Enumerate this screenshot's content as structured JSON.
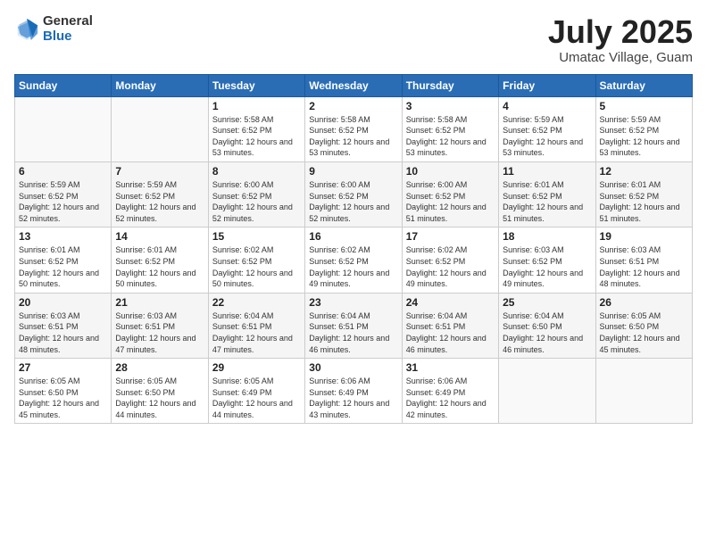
{
  "logo": {
    "general": "General",
    "blue": "Blue"
  },
  "header": {
    "month": "July 2025",
    "location": "Umatac Village, Guam"
  },
  "weekdays": [
    "Sunday",
    "Monday",
    "Tuesday",
    "Wednesday",
    "Thursday",
    "Friday",
    "Saturday"
  ],
  "weeks": [
    [
      {
        "day": "",
        "detail": ""
      },
      {
        "day": "",
        "detail": ""
      },
      {
        "day": "1",
        "detail": "Sunrise: 5:58 AM\nSunset: 6:52 PM\nDaylight: 12 hours and 53 minutes."
      },
      {
        "day": "2",
        "detail": "Sunrise: 5:58 AM\nSunset: 6:52 PM\nDaylight: 12 hours and 53 minutes."
      },
      {
        "day": "3",
        "detail": "Sunrise: 5:58 AM\nSunset: 6:52 PM\nDaylight: 12 hours and 53 minutes."
      },
      {
        "day": "4",
        "detail": "Sunrise: 5:59 AM\nSunset: 6:52 PM\nDaylight: 12 hours and 53 minutes."
      },
      {
        "day": "5",
        "detail": "Sunrise: 5:59 AM\nSunset: 6:52 PM\nDaylight: 12 hours and 53 minutes."
      }
    ],
    [
      {
        "day": "6",
        "detail": "Sunrise: 5:59 AM\nSunset: 6:52 PM\nDaylight: 12 hours and 52 minutes."
      },
      {
        "day": "7",
        "detail": "Sunrise: 5:59 AM\nSunset: 6:52 PM\nDaylight: 12 hours and 52 minutes."
      },
      {
        "day": "8",
        "detail": "Sunrise: 6:00 AM\nSunset: 6:52 PM\nDaylight: 12 hours and 52 minutes."
      },
      {
        "day": "9",
        "detail": "Sunrise: 6:00 AM\nSunset: 6:52 PM\nDaylight: 12 hours and 52 minutes."
      },
      {
        "day": "10",
        "detail": "Sunrise: 6:00 AM\nSunset: 6:52 PM\nDaylight: 12 hours and 51 minutes."
      },
      {
        "day": "11",
        "detail": "Sunrise: 6:01 AM\nSunset: 6:52 PM\nDaylight: 12 hours and 51 minutes."
      },
      {
        "day": "12",
        "detail": "Sunrise: 6:01 AM\nSunset: 6:52 PM\nDaylight: 12 hours and 51 minutes."
      }
    ],
    [
      {
        "day": "13",
        "detail": "Sunrise: 6:01 AM\nSunset: 6:52 PM\nDaylight: 12 hours and 50 minutes."
      },
      {
        "day": "14",
        "detail": "Sunrise: 6:01 AM\nSunset: 6:52 PM\nDaylight: 12 hours and 50 minutes."
      },
      {
        "day": "15",
        "detail": "Sunrise: 6:02 AM\nSunset: 6:52 PM\nDaylight: 12 hours and 50 minutes."
      },
      {
        "day": "16",
        "detail": "Sunrise: 6:02 AM\nSunset: 6:52 PM\nDaylight: 12 hours and 49 minutes."
      },
      {
        "day": "17",
        "detail": "Sunrise: 6:02 AM\nSunset: 6:52 PM\nDaylight: 12 hours and 49 minutes."
      },
      {
        "day": "18",
        "detail": "Sunrise: 6:03 AM\nSunset: 6:52 PM\nDaylight: 12 hours and 49 minutes."
      },
      {
        "day": "19",
        "detail": "Sunrise: 6:03 AM\nSunset: 6:51 PM\nDaylight: 12 hours and 48 minutes."
      }
    ],
    [
      {
        "day": "20",
        "detail": "Sunrise: 6:03 AM\nSunset: 6:51 PM\nDaylight: 12 hours and 48 minutes."
      },
      {
        "day": "21",
        "detail": "Sunrise: 6:03 AM\nSunset: 6:51 PM\nDaylight: 12 hours and 47 minutes."
      },
      {
        "day": "22",
        "detail": "Sunrise: 6:04 AM\nSunset: 6:51 PM\nDaylight: 12 hours and 47 minutes."
      },
      {
        "day": "23",
        "detail": "Sunrise: 6:04 AM\nSunset: 6:51 PM\nDaylight: 12 hours and 46 minutes."
      },
      {
        "day": "24",
        "detail": "Sunrise: 6:04 AM\nSunset: 6:51 PM\nDaylight: 12 hours and 46 minutes."
      },
      {
        "day": "25",
        "detail": "Sunrise: 6:04 AM\nSunset: 6:50 PM\nDaylight: 12 hours and 46 minutes."
      },
      {
        "day": "26",
        "detail": "Sunrise: 6:05 AM\nSunset: 6:50 PM\nDaylight: 12 hours and 45 minutes."
      }
    ],
    [
      {
        "day": "27",
        "detail": "Sunrise: 6:05 AM\nSunset: 6:50 PM\nDaylight: 12 hours and 45 minutes."
      },
      {
        "day": "28",
        "detail": "Sunrise: 6:05 AM\nSunset: 6:50 PM\nDaylight: 12 hours and 44 minutes."
      },
      {
        "day": "29",
        "detail": "Sunrise: 6:05 AM\nSunset: 6:49 PM\nDaylight: 12 hours and 44 minutes."
      },
      {
        "day": "30",
        "detail": "Sunrise: 6:06 AM\nSunset: 6:49 PM\nDaylight: 12 hours and 43 minutes."
      },
      {
        "day": "31",
        "detail": "Sunrise: 6:06 AM\nSunset: 6:49 PM\nDaylight: 12 hours and 42 minutes."
      },
      {
        "day": "",
        "detail": ""
      },
      {
        "day": "",
        "detail": ""
      }
    ]
  ]
}
